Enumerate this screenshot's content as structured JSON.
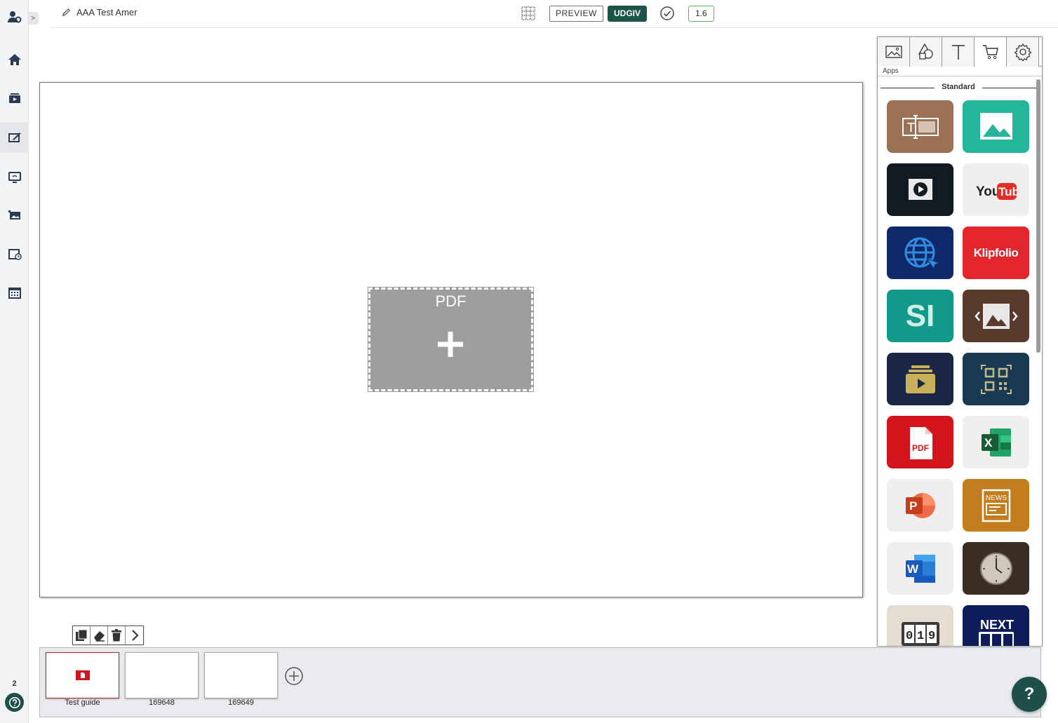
{
  "topbar": {
    "title": "AAA Test Amer",
    "preview_label": "PREVIEW",
    "publish_label": "UDGIV",
    "version": "1.6"
  },
  "rail": {
    "count": "2",
    "toggle": ">"
  },
  "canvas": {
    "widget_label": "PDF"
  },
  "panel": {
    "tab_caption": "Apps",
    "section_title": "Standard",
    "apps": [
      {
        "icon": "text-app-icon",
        "bg": "#9c7257"
      },
      {
        "icon": "image-app-icon",
        "bg": "#24b59b"
      },
      {
        "icon": "video-app-icon",
        "bg": "#121a24"
      },
      {
        "icon": "youtube-app-icon",
        "bg": "#efefef"
      },
      {
        "icon": "web-app-icon",
        "bg": "#0e2a6b"
      },
      {
        "icon": "klipfolio-app-icon",
        "bg": "#e3262d",
        "text": "Klipfolio"
      },
      {
        "icon": "si-app-icon",
        "bg": "#13998a",
        "text": "SI"
      },
      {
        "icon": "slideshow-app-icon",
        "bg": "#5a3a2c"
      },
      {
        "icon": "media-playlist-app-icon",
        "bg": "#1a2747"
      },
      {
        "icon": "qr-code-app-icon",
        "bg": "#183a52"
      },
      {
        "icon": "pdf-app-icon",
        "bg": "#d3141c"
      },
      {
        "icon": "excel-app-icon",
        "bg": "#efefef"
      },
      {
        "icon": "powerpoint-app-icon",
        "bg": "#efefef"
      },
      {
        "icon": "news-app-icon",
        "bg": "#c47d1e"
      },
      {
        "icon": "word-app-icon",
        "bg": "#efefef"
      },
      {
        "icon": "clock-app-icon",
        "bg": "#3a2e24"
      },
      {
        "icon": "counter-app-icon",
        "bg": "#e6dcd2"
      },
      {
        "icon": "next-counter-app-icon",
        "bg": "#0e1c5c"
      }
    ]
  },
  "tray": {
    "slides": [
      {
        "label": "Test guide"
      },
      {
        "label": "169648"
      },
      {
        "label": "169649"
      }
    ]
  },
  "help_label": "?"
}
